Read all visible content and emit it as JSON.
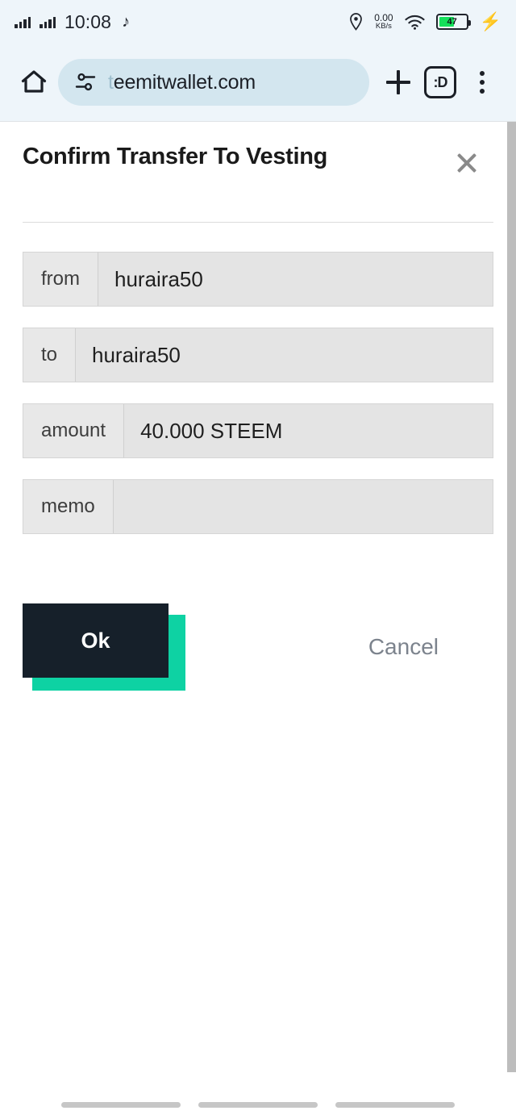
{
  "status_bar": {
    "time": "10:08",
    "net_speed_value": "0.00",
    "net_speed_unit": "KB/s",
    "battery_level": "47",
    "battery_color": "#14e05a",
    "charging_icon": "bolt-icon",
    "tiktok_icon": "music-note-icon",
    "location_icon": "location-pin-icon",
    "wifi_icon": "wifi-icon",
    "signal_icon": "signal-bars-icon"
  },
  "browser": {
    "home_icon": "home-icon",
    "site_settings_icon": "tune-icon",
    "url": "teemitwallet.com",
    "url_dim_prefix": "t",
    "url_rest": "eemitwallet.com",
    "new_tab_icon": "plus-icon",
    "tab_switcher_label": ":D",
    "menu_icon": "kebab-menu-icon"
  },
  "dialog": {
    "title": "Confirm Transfer To Vesting",
    "close_icon": "close-icon",
    "fields": [
      {
        "label": "from",
        "value": "huraira50"
      },
      {
        "label": "to",
        "value": "huraira50"
      },
      {
        "label": "amount",
        "value": "40.000 STEEM"
      },
      {
        "label": "memo",
        "value": ""
      }
    ],
    "ok_label": "Ok",
    "cancel_label": "Cancel",
    "ok_accent_color": "#0ed2a3",
    "ok_background_color": "#16202a"
  },
  "nav_bar": {
    "bars": [
      "nav-bar-left",
      "nav-bar-center",
      "nav-bar-right"
    ]
  }
}
